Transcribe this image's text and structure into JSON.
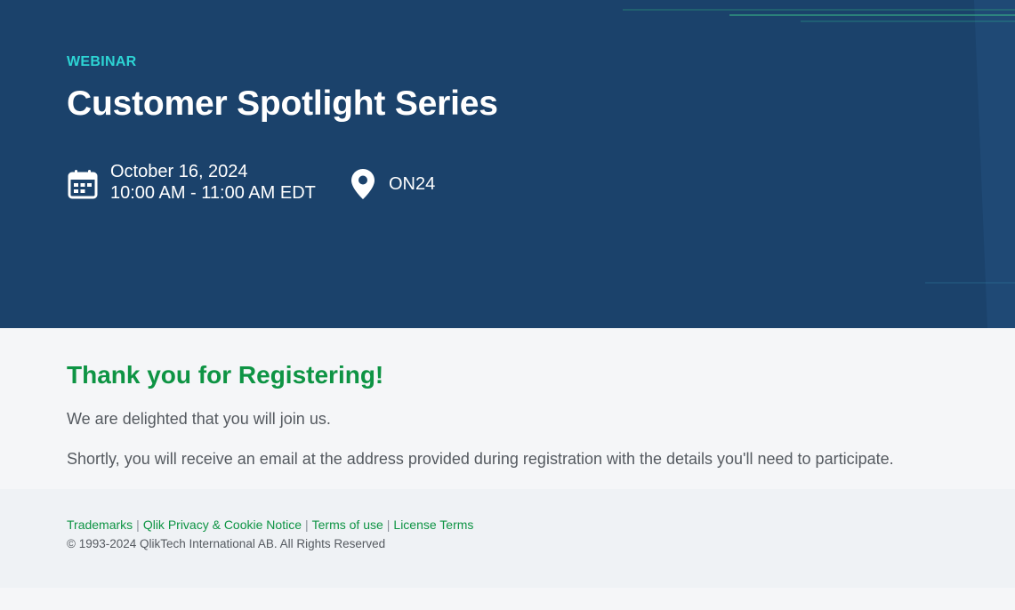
{
  "hero": {
    "eyebrow": "WEBINAR",
    "title": "Customer Spotlight Series",
    "date_line": "October 16, 2024",
    "time_line": "10:00 AM - 11:00 AM EDT",
    "location": "ON24",
    "calendar_icon": "calendar-icon",
    "location_icon": "map-pin-icon"
  },
  "confirmation": {
    "heading": "Thank you for Registering!",
    "line1": "We are delighted that you will join us.",
    "line2": "Shortly, you will receive an email at the address provided during registration with the details you'll need to participate."
  },
  "footer": {
    "links": [
      "Trademarks",
      "Qlik Privacy & Cookie Notice",
      "Terms of use",
      "License Terms"
    ],
    "separator": "|",
    "copyright": "© 1993-2024 QlikTech International AB. All Rights Reserved"
  },
  "colors": {
    "hero_bg": "#1b426b",
    "eyebrow": "#2dd4d4",
    "accent_green": "#0e9444",
    "body_text": "#555a60"
  }
}
